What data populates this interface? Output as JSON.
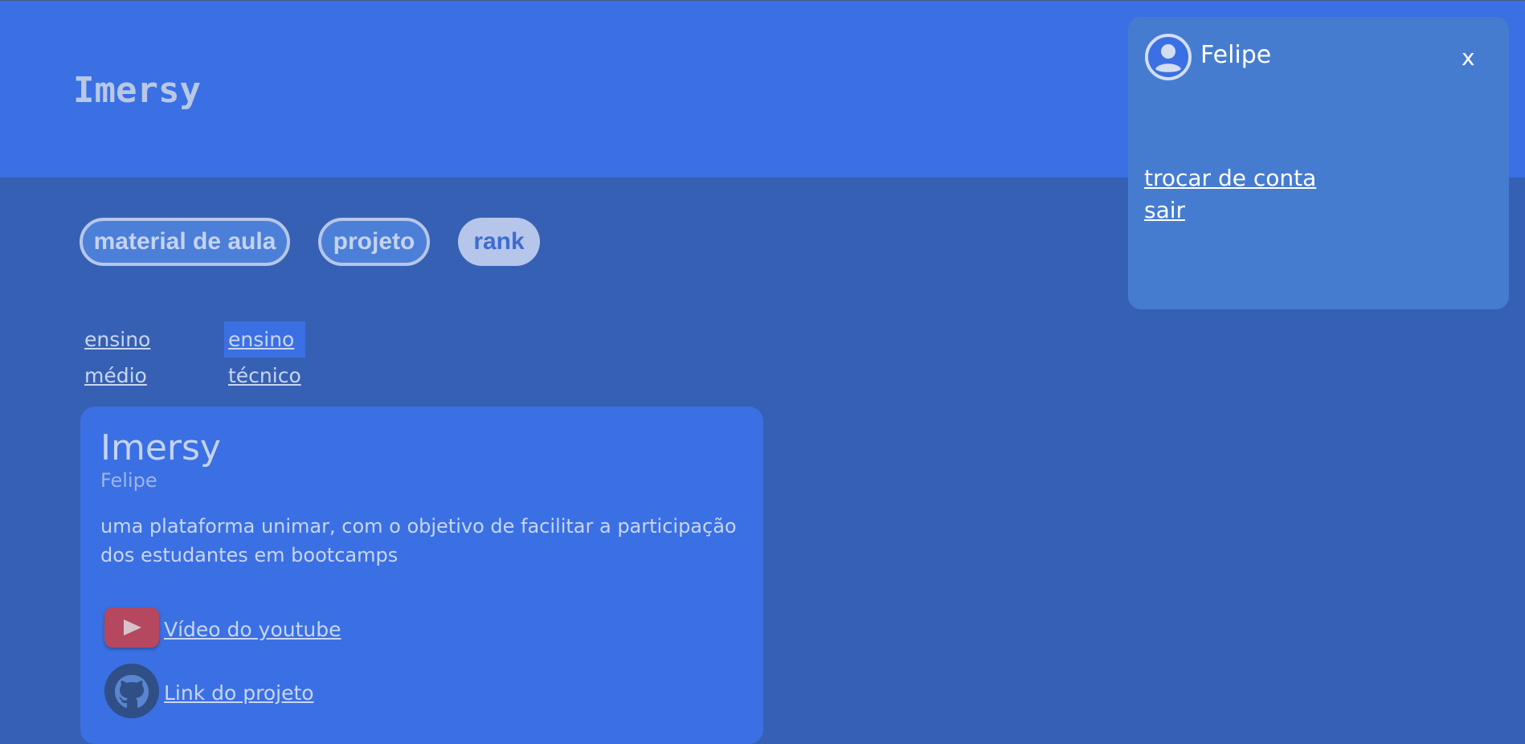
{
  "header": {
    "logo": "Imersy"
  },
  "tabs": [
    {
      "label": "material de aula",
      "style": "outline"
    },
    {
      "label": "projeto",
      "style": "outline"
    },
    {
      "label": "rank",
      "style": "filled"
    }
  ],
  "subtabs": [
    {
      "label": "ensino médio",
      "active": false
    },
    {
      "label": "ensino técnico",
      "active": true
    }
  ],
  "card": {
    "title": "Imersy",
    "author": "Felipe",
    "description": "uma plataforma unimar, com o objetivo de facilitar a participação dos estudantes em bootcamps",
    "youtube_link": "Vídeo do youtube",
    "project_link": "Link do projeto"
  },
  "popup": {
    "user_name": "Felipe",
    "close_label": "x",
    "switch_account": "trocar de conta",
    "logout": "sair"
  },
  "icons": {
    "avatar": "user-circle-icon",
    "youtube": "youtube-icon",
    "github": "github-icon"
  },
  "colors": {
    "header_bg": "#3a70e3",
    "page_bg": "#3660b3",
    "popup_bg": "#467cd0",
    "youtube_red": "#b5475f"
  }
}
